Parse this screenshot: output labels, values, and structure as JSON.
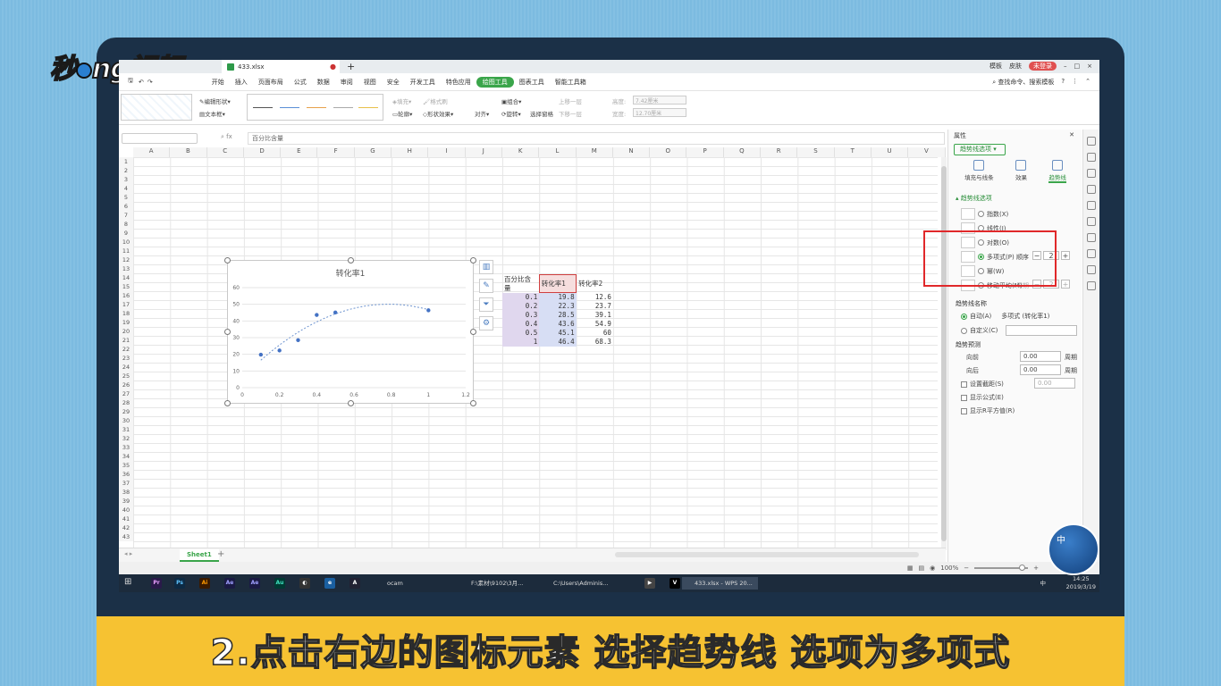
{
  "watermark": {
    "logo_a": "秒",
    "logo_b": "ng视频"
  },
  "window": {
    "tab_title": "433.xlsx",
    "right_items": [
      "模板",
      "皮肤"
    ],
    "login_label": "未登录"
  },
  "menu": {
    "items": [
      "开始",
      "插入",
      "页面布局",
      "公式",
      "数据",
      "审阅",
      "视图",
      "安全",
      "开发工具",
      "特色应用",
      "绘图工具",
      "图表工具",
      "智能工具箱"
    ],
    "active_index": 10,
    "search_label": "查找命令、搜索模板"
  },
  "ribbon": {
    "edit_shape": "编辑形状",
    "text_box": "文本框",
    "fill": "填充",
    "outline": "轮廓",
    "shape_effect": "形状效果",
    "format_brush": "格式刷",
    "align": "对齐",
    "group": "组合",
    "rotate": "旋转",
    "select_pane": "选择窗格",
    "up_one": "上移一层",
    "down_one": "下移一层",
    "height_label": "高度:",
    "height_value": "7.42厘米",
    "width_label": "宽度:",
    "width_value": "12.70厘米"
  },
  "formula_bar": {
    "content": "百分比含量"
  },
  "columns": [
    "A",
    "B",
    "C",
    "D",
    "E",
    "F",
    "G",
    "H",
    "I",
    "J",
    "K",
    "L",
    "M",
    "N",
    "O",
    "P",
    "Q",
    "R",
    "S",
    "T",
    "U",
    "V"
  ],
  "rows": [
    "1",
    "2",
    "3",
    "4",
    "5",
    "6",
    "7",
    "8",
    "9",
    "10",
    "11",
    "12",
    "13",
    "14",
    "15",
    "16",
    "17",
    "18",
    "19",
    "20",
    "21",
    "22",
    "23",
    "24",
    "25",
    "26",
    "27",
    "28",
    "29",
    "30",
    "31",
    "32",
    "33",
    "34",
    "35",
    "36",
    "37",
    "38",
    "39",
    "40",
    "41",
    "42",
    "43"
  ],
  "table": {
    "headers": [
      "百分比含量",
      "转化率1",
      "转化率2"
    ],
    "rows": [
      [
        "0.1",
        "19.8",
        "12.6"
      ],
      [
        "0.2",
        "22.3",
        "23.7"
      ],
      [
        "0.3",
        "28.5",
        "39.1"
      ],
      [
        "0.4",
        "43.6",
        "54.9"
      ],
      [
        "0.5",
        "45.1",
        "60"
      ],
      [
        "1",
        "46.4",
        "68.3"
      ]
    ]
  },
  "chart_data": {
    "type": "scatter",
    "title": "转化率1",
    "x": [
      0.1,
      0.2,
      0.3,
      0.4,
      0.5,
      1
    ],
    "series": [
      {
        "values": [
          19.8,
          22.3,
          28.5,
          43.6,
          45.1,
          46.4
        ]
      }
    ],
    "trendline": "polynomial order 2",
    "xlim": [
      0,
      1.2
    ],
    "ylim": [
      0,
      60
    ],
    "xticks": [
      "0",
      "0.2",
      "0.4",
      "0.6",
      "0.8",
      "1",
      "1.2"
    ],
    "yticks": [
      "0",
      "10",
      "20",
      "30",
      "40",
      "50",
      "60"
    ],
    "grid": true,
    "marker_color": "#4472c4"
  },
  "sheet": {
    "tab": "Sheet1"
  },
  "panel": {
    "title": "属性",
    "trend_tab": "趋势线选项",
    "subtabs": [
      "填充与线条",
      "效果",
      "趋势线"
    ],
    "section": "趋势线选项",
    "options": [
      "指数(X)",
      "线性(I)",
      "对数(O)",
      "多项式(P)",
      "幂(W)",
      "移动平均(M)"
    ],
    "order_label": "顺序",
    "order_value": "2",
    "period_label": "周期",
    "period_value": "2",
    "name_section": "趋势线名称",
    "auto_label": "自动(A)",
    "auto_value": "多项式 (转化率1)",
    "custom_label": "自定义(C)",
    "forecast_section": "趋势预测",
    "forward_label": "向前",
    "forward_value": "0.00",
    "backward_label": "向后",
    "backward_value": "0.00",
    "unit": "周期",
    "intercept_label": "设置截距(S)",
    "intercept_value": "0.00",
    "show_eq": "显示公式(E)",
    "show_r2": "显示R平方值(R)"
  },
  "status": {
    "zoom": "100%"
  },
  "taskbar": {
    "items": [
      "ocam",
      "F:\\素材\\9102\\3月...",
      "C:\\Users\\Adminis...",
      "433.xlsx - WPS 20..."
    ],
    "icon_labels": [
      "Pr",
      "Ps",
      "Ai",
      "Ae",
      "Ae",
      "Au"
    ],
    "tray": "中",
    "time": "14:25",
    "date": "2019/3/19"
  },
  "badge": {
    "text": "中"
  },
  "caption": "2.点击右边的图标元素 选择趋势线 选项为多项式"
}
